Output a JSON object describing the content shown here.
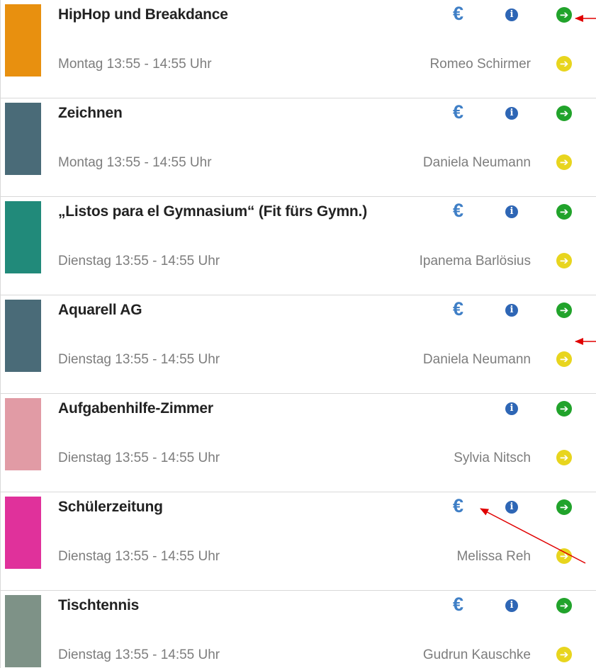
{
  "courses": [
    {
      "title": "HipHop und Breakdance",
      "time": "Montag 13:55 - 14:55 Uhr",
      "teacher": "Romeo Schirmer",
      "color": "#e8900f",
      "euro": "€"
    },
    {
      "title": "Zeichnen",
      "time": "Montag 13:55 - 14:55 Uhr",
      "teacher": "Daniela Neumann",
      "color": "#4a6b78",
      "euro": "€"
    },
    {
      "title": "„Listos para el Gymnasium“ (Fit fürs Gymn.)",
      "time": "Dienstag 13:55 - 14:55 Uhr",
      "teacher": "Ipanema Barlösius",
      "color": "#218a7a",
      "euro": "€"
    },
    {
      "title": "Aquarell AG",
      "time": "Dienstag 13:55 - 14:55 Uhr",
      "teacher": "Daniela Neumann",
      "color": "#4a6b78",
      "euro": "€"
    },
    {
      "title": "Aufgabenhilfe-Zimmer",
      "time": "Dienstag 13:55 - 14:55 Uhr",
      "teacher": "Sylvia Nitsch",
      "color": "#e19ba5",
      "euro": ""
    },
    {
      "title": "Schülerzeitung",
      "time": "Dienstag 13:55 - 14:55 Uhr",
      "teacher": "Melissa Reh",
      "color": "#e0319b",
      "euro": "€"
    },
    {
      "title": "Tischtennis",
      "time": "Dienstag 13:55 - 14:55 Uhr",
      "teacher": "Gudrun Kauschke",
      "color": "#7e9287",
      "euro": "€"
    }
  ],
  "icons": {
    "info": "i",
    "arrow": "➔"
  },
  "colors": {
    "euro": "#3f7fc6",
    "info": "#2e66b5",
    "arrow_green": "#21a32b",
    "arrow_yellow": "#e8d51e",
    "annotation": "#e00000"
  }
}
